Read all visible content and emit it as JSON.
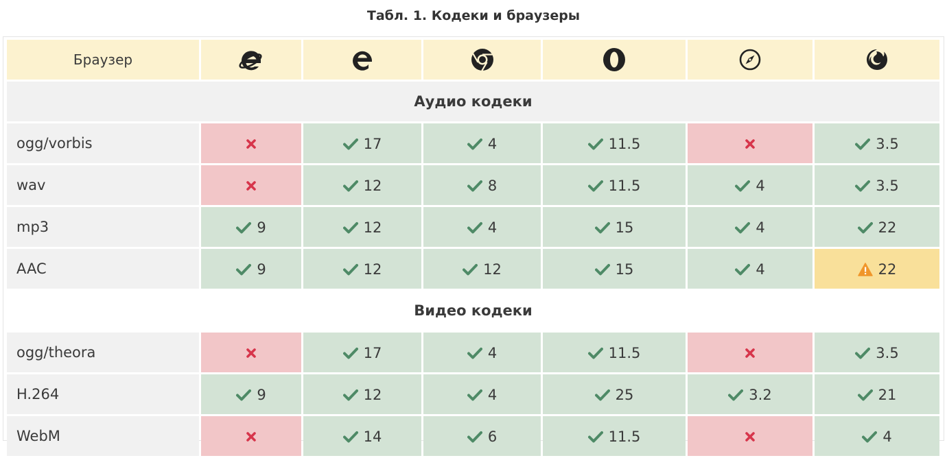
{
  "caption": "Табл. 1. Кодеки и браузеры",
  "header": {
    "label": "Браузер",
    "browsers": [
      {
        "icon": "internet-explorer-icon"
      },
      {
        "icon": "edge-icon"
      },
      {
        "icon": "chrome-icon"
      },
      {
        "icon": "opera-icon"
      },
      {
        "icon": "safari-icon"
      },
      {
        "icon": "firefox-icon"
      }
    ]
  },
  "sections": [
    {
      "title": "Аудио кодеки",
      "rows": [
        {
          "codec": "ogg/vorbis",
          "cells": [
            {
              "status": "no",
              "version": ""
            },
            {
              "status": "yes",
              "version": "17"
            },
            {
              "status": "yes",
              "version": "4"
            },
            {
              "status": "yes",
              "version": "11.5"
            },
            {
              "status": "no",
              "version": ""
            },
            {
              "status": "yes",
              "version": "3.5"
            }
          ]
        },
        {
          "codec": "wav",
          "cells": [
            {
              "status": "no",
              "version": ""
            },
            {
              "status": "yes",
              "version": "12"
            },
            {
              "status": "yes",
              "version": "8"
            },
            {
              "status": "yes",
              "version": "11.5"
            },
            {
              "status": "yes",
              "version": "4"
            },
            {
              "status": "yes",
              "version": "3.5"
            }
          ]
        },
        {
          "codec": "mp3",
          "cells": [
            {
              "status": "yes",
              "version": "9"
            },
            {
              "status": "yes",
              "version": "12"
            },
            {
              "status": "yes",
              "version": "4"
            },
            {
              "status": "yes",
              "version": "15"
            },
            {
              "status": "yes",
              "version": "4"
            },
            {
              "status": "yes",
              "version": "22"
            }
          ]
        },
        {
          "codec": "AAC",
          "cells": [
            {
              "status": "yes",
              "version": "9"
            },
            {
              "status": "yes",
              "version": "12"
            },
            {
              "status": "yes",
              "version": "12"
            },
            {
              "status": "yes",
              "version": "15"
            },
            {
              "status": "yes",
              "version": "4"
            },
            {
              "status": "partial",
              "version": "22"
            }
          ]
        }
      ]
    },
    {
      "title": "Видео кодеки",
      "rows": [
        {
          "codec": "ogg/theora",
          "cells": [
            {
              "status": "no",
              "version": ""
            },
            {
              "status": "yes",
              "version": "17"
            },
            {
              "status": "yes",
              "version": "4"
            },
            {
              "status": "yes",
              "version": "11.5"
            },
            {
              "status": "no",
              "version": ""
            },
            {
              "status": "yes",
              "version": "3.5"
            }
          ]
        },
        {
          "codec": "H.264",
          "cells": [
            {
              "status": "yes",
              "version": "9"
            },
            {
              "status": "yes",
              "version": "12"
            },
            {
              "status": "yes",
              "version": "4"
            },
            {
              "status": "yes",
              "version": "25"
            },
            {
              "status": "yes",
              "version": "3.2"
            },
            {
              "status": "yes",
              "version": "21"
            }
          ]
        },
        {
          "codec": "WebM",
          "cells": [
            {
              "status": "no",
              "version": ""
            },
            {
              "status": "yes",
              "version": "14"
            },
            {
              "status": "yes",
              "version": "6"
            },
            {
              "status": "yes",
              "version": "11.5"
            },
            {
              "status": "no",
              "version": ""
            },
            {
              "status": "yes",
              "version": "4"
            }
          ]
        }
      ]
    }
  ],
  "colors": {
    "yes_bg": "#d3e3d5",
    "no_bg": "#f2c6c8",
    "partial_bg": "#f9e09a",
    "header_bg": "#fcf2cf",
    "check": "#4e8a66",
    "cross": "#d7354b",
    "warning": "#f0962a"
  }
}
